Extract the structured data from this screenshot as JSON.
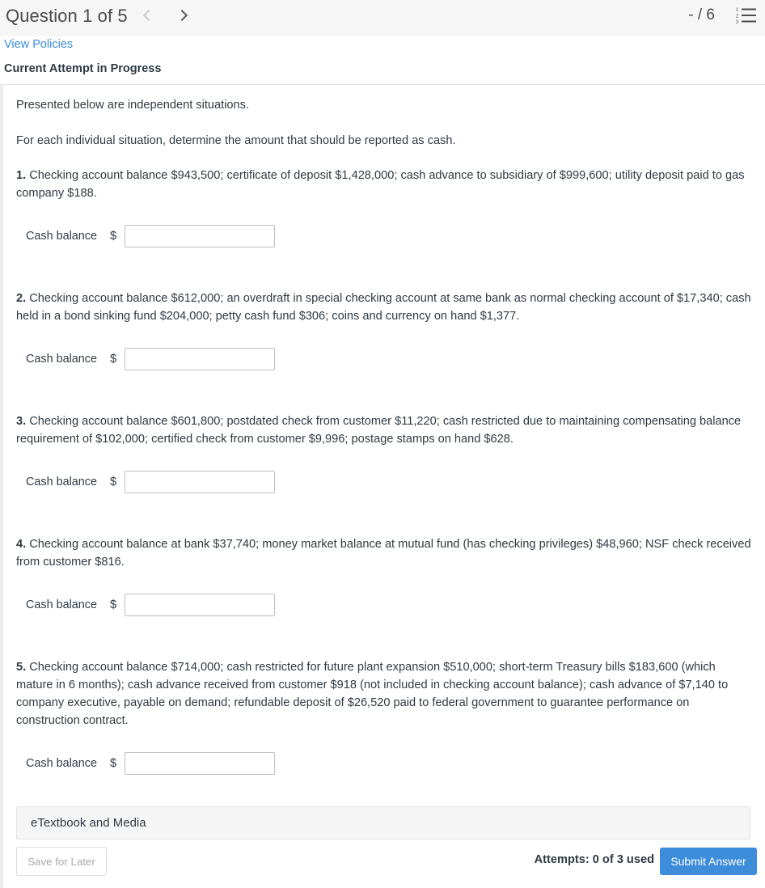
{
  "header": {
    "question_title": "Question 1 of 5",
    "prev_icon": "chevron-left-icon",
    "next_icon": "chevron-right-icon",
    "score": "- / 6",
    "list_icon": "numbered-list-icon"
  },
  "subheader": {
    "view_policies": "View Policies",
    "attempt_status": "Current Attempt in Progress"
  },
  "body": {
    "intro_1": "Presented below are independent situations.",
    "intro_2": "For each individual situation, determine the amount that should be reported as cash.",
    "situations": [
      {
        "number": "1.",
        "text": " Checking account balance $943,500; certificate of deposit $1,428,000; cash advance to subsidiary of $999,600; utility deposit paid to gas company $188.",
        "answer_label": "Cash balance",
        "currency_symbol": "$",
        "answer_value": ""
      },
      {
        "number": "2.",
        "text": " Checking account balance $612,000; an overdraft in special checking account at same bank as normal checking account of $17,340; cash held in a bond sinking fund $204,000; petty cash fund $306; coins and currency on hand $1,377.",
        "answer_label": "Cash balance",
        "currency_symbol": "$",
        "answer_value": ""
      },
      {
        "number": "3.",
        "text": " Checking account balance $601,800; postdated check from customer $11,220; cash restricted due to maintaining compensating balance requirement of $102,000; certified check from customer $9,996; postage stamps on hand $628.",
        "answer_label": "Cash balance",
        "currency_symbol": "$",
        "answer_value": ""
      },
      {
        "number": "4.",
        "text": " Checking account balance at bank $37,740; money market balance at mutual fund (has checking privileges) $48,960; NSF check received from customer $816.",
        "answer_label": "Cash balance",
        "currency_symbol": "$",
        "answer_value": ""
      },
      {
        "number": "5.",
        "text": " Checking account balance $714,000; cash restricted for future plant expansion $510,000; short-term Treasury bills $183,600 (which mature in 6 months); cash advance received from customer $918 (not included in checking account balance); cash advance of $7,140 to company executive, payable on demand; refundable deposit of $26,520 paid to federal government to guarantee performance on construction contract.",
        "answer_label": "Cash balance",
        "currency_symbol": "$",
        "answer_value": ""
      }
    ]
  },
  "footer": {
    "etextbook_label": "eTextbook and Media",
    "save_for_later_label": "Save for Later",
    "attempts_label": "Attempts: 0 of 3 used",
    "submit_label": "Submit Answer"
  },
  "colors": {
    "accent_blue": "#3d8ddb",
    "link_blue": "#3a8ddc",
    "header_bg": "#f6f6f6",
    "text": "#2f3a45"
  }
}
